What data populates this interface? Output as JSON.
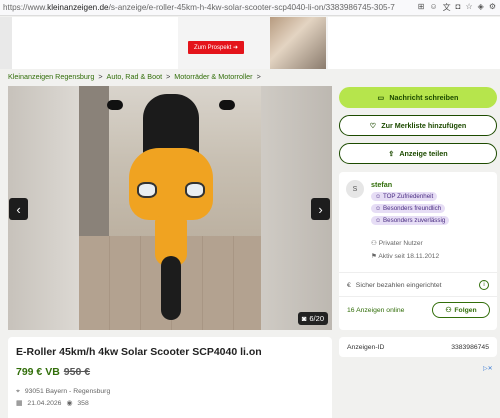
{
  "browser": {
    "url_prefix": "https://www.",
    "url_domain": "kleinanzeigen.de",
    "url_rest": "/s-anzeige/e-roller-45km-h-4kw-solar-scooter-scp4040-li-on/3383986745-305-7",
    "icons": [
      "grid-icon",
      "smile-icon",
      "translate-icon",
      "camera-icon",
      "star-icon",
      "shield-icon",
      "extensions-icon"
    ]
  },
  "ad": {
    "prospekt_label": "Zum Prospekt ➜"
  },
  "breadcrumb": {
    "items": [
      "Kleinanzeigen Regensburg",
      "Auto, Rad & Boot",
      "Motorräder & Motorroller"
    ],
    "separator": ">"
  },
  "gallery": {
    "counter": "6/20"
  },
  "listing": {
    "title": "E-Roller 45km/h 4kw Solar Scooter SCP4040 li.on",
    "price": "799 € VB",
    "old_price": "950 €",
    "location": "93051 Bayern - Regensburg",
    "date": "21.04.2026",
    "views": "358"
  },
  "actions": {
    "message": "Nachricht schreiben",
    "favorite": "Zur Merkliste hinzufügen",
    "share": "Anzeige teilen"
  },
  "seller": {
    "initial": "S",
    "name": "stefan",
    "badges": [
      "TOP Zufriedenheit",
      "Besonders freundlich",
      "Besonders zuverlässig"
    ],
    "type": "Privater Nutzer",
    "active_since": "Aktiv seit 18.11.2012",
    "secure_payment": "Sicher bezahlen eingerichtet",
    "online_count": "16 Anzeigen online",
    "follow": "Folgen"
  },
  "ad_id": {
    "label": "Anzeigen-ID",
    "value": "3383986745"
  },
  "colors": {
    "brand_green": "#326e0a",
    "primary_button": "#b6e54c",
    "badge_purple": "#e6ddf5"
  }
}
